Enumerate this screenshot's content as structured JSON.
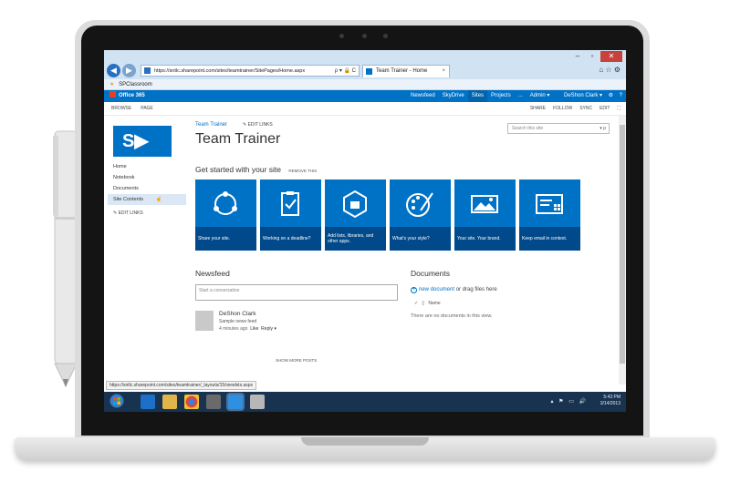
{
  "browser": {
    "address": "https://sntlc.sharepoint.com/sites/teamtrainer/SitePages/Home.aspx",
    "tab_title": "Team Trainer - Home",
    "favorite": "SPClassroom",
    "win_min": "–",
    "win_max": "▫",
    "win_close": "✕",
    "addr_tools": "ρ ▾ 🔒 C",
    "tab_close": "×",
    "home_icons": "⌂ ☆ ⚙"
  },
  "suite": {
    "brand": "Office 365",
    "nav": [
      "Newsfeed",
      "SkyDrive",
      "Sites",
      "Projects",
      "...",
      "Admin ▾"
    ],
    "user": "DeShon Clark ▾",
    "gear": "⚙",
    "help": "?"
  },
  "ribbon": {
    "left": [
      "BROWSE",
      "PAGE"
    ],
    "right": [
      "SHARE",
      "FOLLOW",
      "SYNC",
      "EDIT",
      "⛶"
    ]
  },
  "site": {
    "logo_text": "S",
    "breadcrumb": "Team Trainer",
    "edit_links": "EDIT LINKS",
    "title": "Team Trainer",
    "search_placeholder": "Search this site",
    "search_icons": "▾ ρ"
  },
  "quicklaunch": {
    "items": [
      "Home",
      "Notebook",
      "Documents",
      "Site Contents"
    ],
    "edit_links": "EDIT LINKS"
  },
  "getstarted": {
    "heading": "Get started with your site",
    "remove": "REMOVE THIS",
    "tiles": [
      {
        "caption": "Share your site.",
        "icon": "share-icon"
      },
      {
        "caption": "Working on a deadline?",
        "icon": "clipboard-icon"
      },
      {
        "caption": "Add lists, libraries, and other apps.",
        "icon": "apps-icon"
      },
      {
        "caption": "What's your style?",
        "icon": "palette-icon"
      },
      {
        "caption": "Your site. Your brand.",
        "icon": "image-icon"
      },
      {
        "caption": "Keep email in context.",
        "icon": "email-icon"
      }
    ]
  },
  "newsfeed": {
    "heading": "Newsfeed",
    "placeholder": "Start a conversation",
    "post": {
      "name": "DeShon Clark",
      "text": "Sample news feed",
      "time": "4 minutes ago",
      "like": "Like",
      "reply": "Reply ▾"
    },
    "show_more": "SHOW MORE POSTS"
  },
  "documents": {
    "heading": "Documents",
    "new_link": "new document",
    "new_rest": " or drag files here",
    "column_check": "✓",
    "column_name": "Name",
    "empty": "There are no documents in this view."
  },
  "status": {
    "url": "https://sntlc.sharepoint.com/sites/teamtrainer/_layouts/15/viewlsts.aspx"
  },
  "taskbar": {
    "time": "5:43 PM",
    "date": "3/14/2013",
    "tray_icons": "▴ ⚑ ▭ 🔊"
  }
}
